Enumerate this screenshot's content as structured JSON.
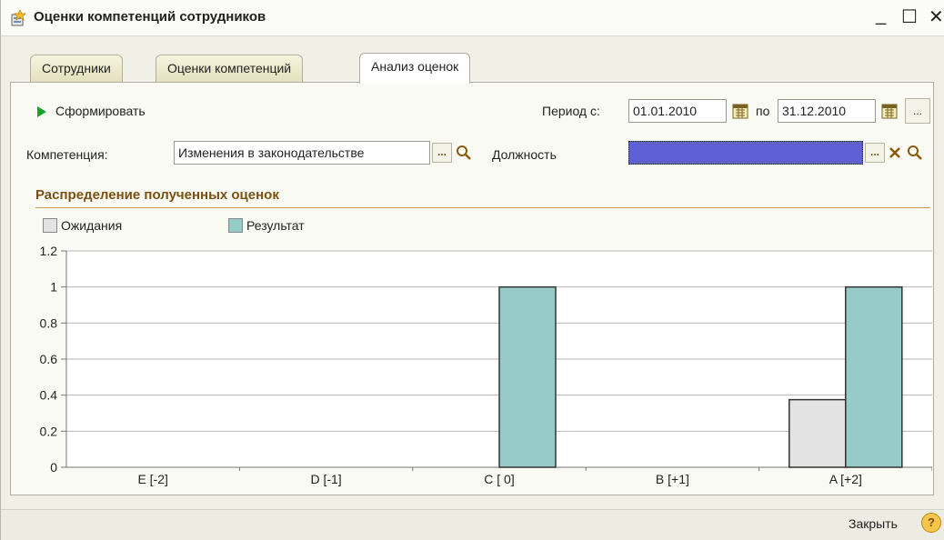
{
  "window": {
    "title": "Оценки компетенций сотрудников",
    "minimize": "_",
    "maximize": "☐",
    "close": "✕"
  },
  "tabs": [
    {
      "label": "Сотрудники",
      "active": false
    },
    {
      "label": "Оценки компетенций",
      "active": false
    },
    {
      "label": "Анализ оценок",
      "active": true
    }
  ],
  "toolbar": {
    "generate_label": "Сформировать",
    "period_from_label": "Период с:",
    "period_from_value": "01.01.2010",
    "period_to_label": "по",
    "period_to_value": "31.12.2010",
    "more_label": "..."
  },
  "filters": {
    "competence_label": "Компетенция:",
    "competence_value": "Изменения в законодательстве",
    "position_label": "Должность",
    "position_value": ""
  },
  "section_title": "Распределение полученных оценок",
  "chart_data": {
    "type": "bar",
    "categories": [
      "E [-2]",
      "D [-1]",
      "C [ 0]",
      "B [+1]",
      "A [+2]"
    ],
    "series": [
      {
        "name": "Ожидания",
        "values": [
          0,
          0,
          0,
          0,
          0.375
        ],
        "color": "#e3e3e3"
      },
      {
        "name": "Результат",
        "values": [
          0,
          0,
          1,
          0,
          1
        ],
        "color": "#96cbc9"
      }
    ],
    "ylim": [
      0,
      1.2
    ],
    "yticks": [
      "0",
      "0.2",
      "0.4",
      "0.6",
      "0.8",
      "1",
      "1.2"
    ],
    "grid": true,
    "legend": "top-left"
  },
  "footer": {
    "close_label": "Закрыть",
    "help_label": "?"
  }
}
